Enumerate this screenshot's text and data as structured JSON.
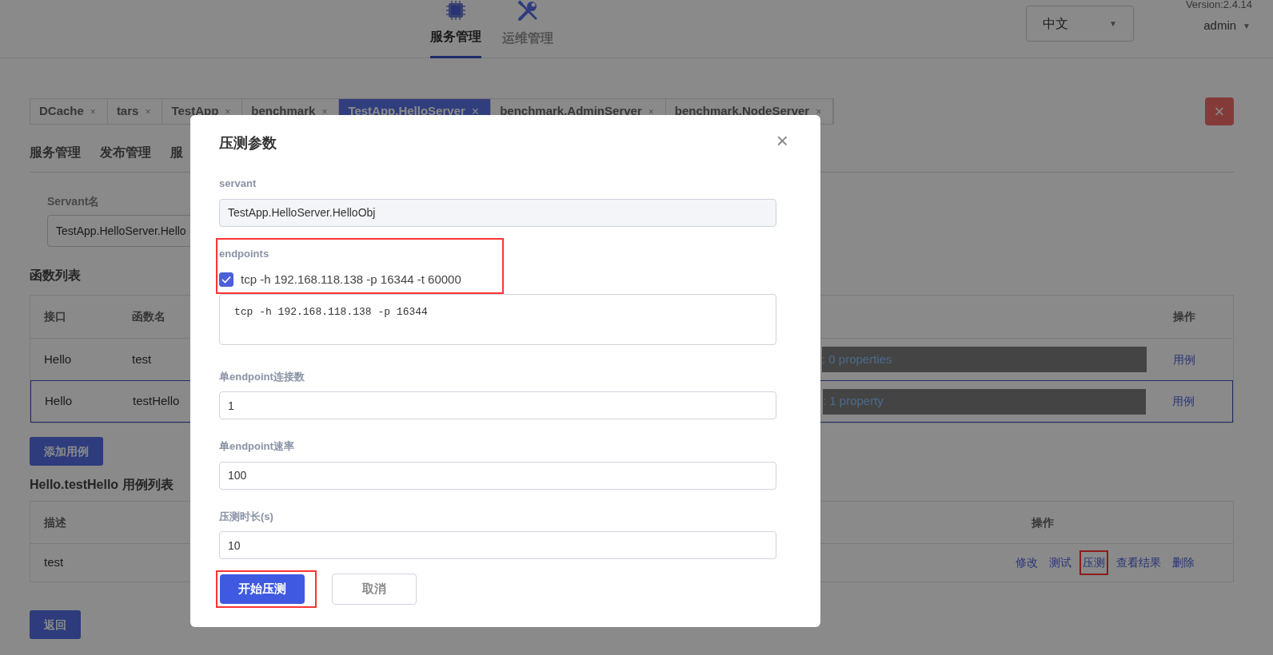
{
  "header": {
    "nav": [
      {
        "label": "服务管理",
        "selected": true
      },
      {
        "label": "运维管理",
        "selected": false
      }
    ],
    "language": "中文",
    "language_caret": "▼",
    "version": "Version:2.4.14",
    "user": "admin",
    "user_caret": "▼"
  },
  "tabs": [
    {
      "label": "DCache",
      "close": "×",
      "selected": false
    },
    {
      "label": "tars",
      "close": "×",
      "selected": false
    },
    {
      "label": "TestApp",
      "close": "×",
      "selected": false
    },
    {
      "label": "benchmark",
      "close": "×",
      "selected": false
    },
    {
      "label": "TestApp.HelloServer",
      "close": "×",
      "selected": true
    },
    {
      "label": "benchmark.AdminServer",
      "close": "×",
      "selected": false
    },
    {
      "label": "benchmark.NodeServer",
      "close": "×",
      "selected": false
    }
  ],
  "close_all_label": "×",
  "subnav": [
    "服务管理",
    "发布管理",
    "服"
  ],
  "servant": {
    "label": "Servant名",
    "value": "TestApp.HelloServer.Hello"
  },
  "functions": {
    "title": "函数列表",
    "columns": [
      "接口",
      "函数名",
      "操作"
    ],
    "rows": [
      {
        "interface": "Hello",
        "name": "test",
        "params": ": 0 properties",
        "action": "用例",
        "selected": false
      },
      {
        "interface": "Hello",
        "name": "testHello",
        "params": ": 1 property",
        "action": "用例",
        "selected": true
      }
    ]
  },
  "add_case_button": "添加用例",
  "cases": {
    "title": "Hello.testHello 用例列表",
    "columns": [
      "描述",
      "操作"
    ],
    "rows": [
      {
        "description": "test",
        "actions": [
          {
            "label": "修改",
            "highlighted": false
          },
          {
            "label": "测试",
            "highlighted": false
          },
          {
            "label": "压测",
            "highlighted": true
          },
          {
            "label": "查看结果",
            "highlighted": false
          },
          {
            "label": "删除",
            "highlighted": false
          }
        ]
      }
    ]
  },
  "back_button": "返回",
  "dialog": {
    "title": "压测参数",
    "close": "×",
    "servant": {
      "label": "servant",
      "value": "TestApp.HelloServer.HelloObj"
    },
    "endpoints": {
      "label": "endpoints",
      "highlighted": true,
      "options": [
        {
          "label": "tcp -h 192.168.118.138 -p 16344 -t 60000",
          "checked": true
        }
      ],
      "value": "tcp -h 192.168.118.138 -p 16344"
    },
    "fields": [
      {
        "label": "单endpoint连接数",
        "value": "1"
      },
      {
        "label": "单endpoint速率",
        "value": "100"
      },
      {
        "label": "压测时长(s)",
        "value": "10"
      }
    ],
    "buttons": [
      {
        "label": "开始压测",
        "kind": "primary",
        "highlighted": true
      },
      {
        "label": "取消",
        "kind": "secondary",
        "highlighted": false
      }
    ]
  }
}
